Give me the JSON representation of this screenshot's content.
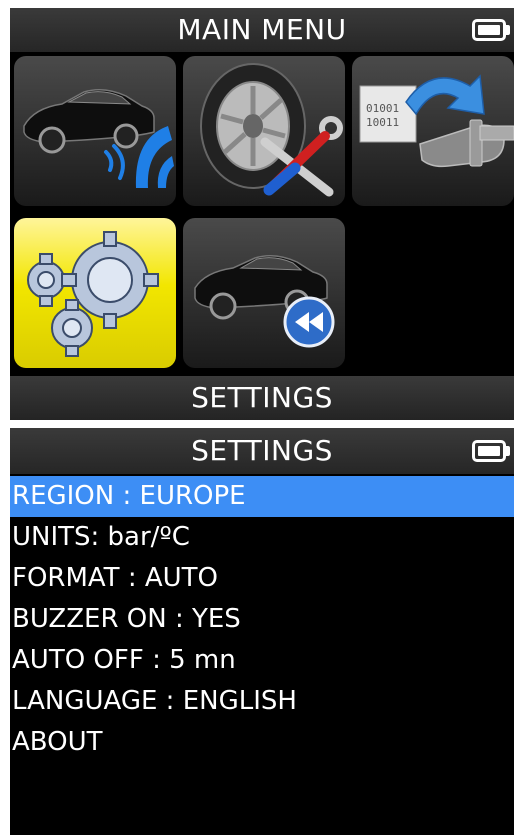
{
  "main_menu": {
    "title": "MAIN MENU",
    "selected_label": "SETTINGS",
    "icons": [
      "car-wireless-icon",
      "tire-tools-icon",
      "sensor-programming-icon",
      "settings-gears-icon",
      "car-rewind-icon"
    ]
  },
  "settings": {
    "title": "SETTINGS",
    "items": [
      {
        "label": "REGION : EUROPE",
        "selected": true
      },
      {
        "label": "UNITS: bar/ºC",
        "selected": false
      },
      {
        "label": "FORMAT : AUTO",
        "selected": false
      },
      {
        "label": "BUZZER ON : YES",
        "selected": false
      },
      {
        "label": "AUTO OFF : 5 mn",
        "selected": false
      },
      {
        "label": "LANGUAGE : ENGLISH",
        "selected": false
      },
      {
        "label": "ABOUT",
        "selected": false
      }
    ]
  },
  "colors": {
    "selection": "#3d8ef5",
    "tile_selected": "#f2e600",
    "background": "#000000",
    "text": "#ffffff"
  }
}
